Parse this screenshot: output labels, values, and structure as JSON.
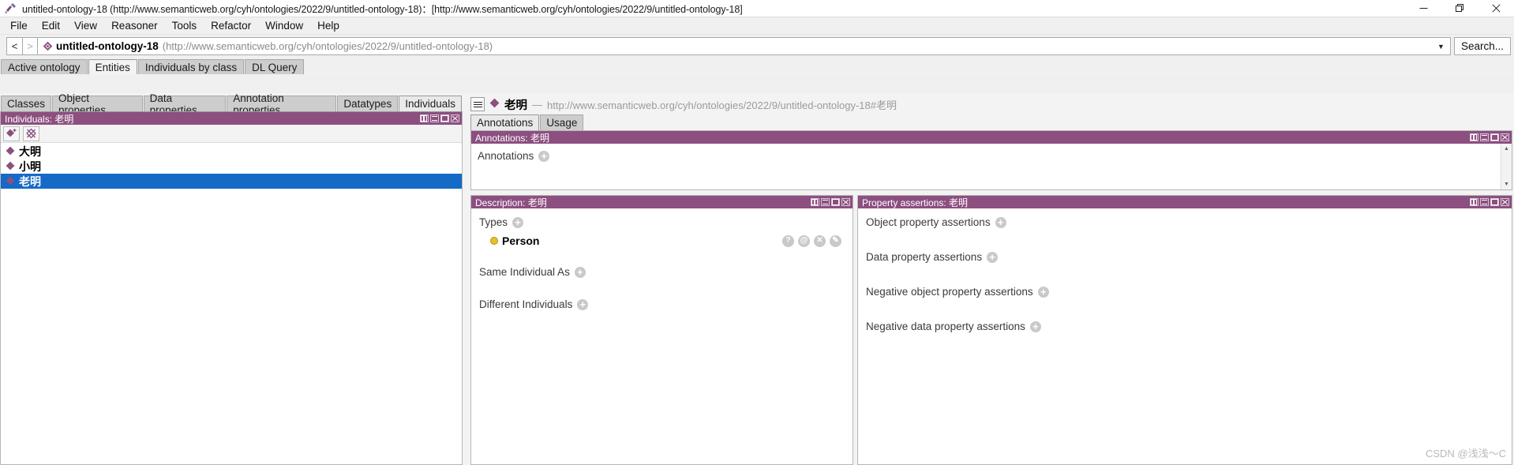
{
  "window": {
    "title": "untitled-ontology-18 (http://www.semanticweb.org/cyh/ontologies/2022/9/untitled-ontology-18)：[http://www.semanticweb.org/cyh/ontologies/2022/9/untitled-ontology-18]",
    "app_icon": "protege-icon",
    "controls": {
      "minimize": "minimize-icon",
      "restore": "restore-icon",
      "close": "close-icon"
    }
  },
  "menubar": {
    "items": [
      {
        "label": "File"
      },
      {
        "label": "Edit"
      },
      {
        "label": "View"
      },
      {
        "label": "Reasoner"
      },
      {
        "label": "Tools"
      },
      {
        "label": "Refactor"
      },
      {
        "label": "Window"
      },
      {
        "label": "Help"
      }
    ]
  },
  "navbar": {
    "back_label": "<",
    "forward_label": ">",
    "entity_name": "untitled-ontology-18",
    "entity_iri": "(http://www.semanticweb.org/cyh/ontologies/2022/9/untitled-ontology-18)",
    "dropdown_icon": "chevron-down-icon",
    "search_label": "Search..."
  },
  "top_tabs": [
    {
      "label": "Active ontology",
      "selected": false
    },
    {
      "label": "Entities",
      "selected": true
    },
    {
      "label": "Individuals by class",
      "selected": false
    },
    {
      "label": "DL Query",
      "selected": false
    }
  ],
  "sub_tabs": [
    {
      "label": "Classes",
      "selected": false
    },
    {
      "label": "Object properties",
      "selected": false
    },
    {
      "label": "Data properties",
      "selected": false
    },
    {
      "label": "Annotation properties",
      "selected": false
    },
    {
      "label": "Datatypes",
      "selected": false
    },
    {
      "label": "Individuals",
      "selected": true
    }
  ],
  "individuals_panel": {
    "header": "Individuals: 老明",
    "toolbar": [
      {
        "name": "add-individual-button",
        "icon": "diamond-plus-icon"
      },
      {
        "name": "delete-individual-button",
        "icon": "diamond-cross-icon"
      }
    ],
    "items": [
      {
        "label": "大明",
        "selected": false
      },
      {
        "label": "小明",
        "selected": false
      },
      {
        "label": "老明",
        "selected": true
      }
    ]
  },
  "entity_header": {
    "menu_icon": "hamburger-icon",
    "entity_icon": "individual-diamond-icon",
    "name": "老明",
    "dash": "—",
    "iri": "http://www.semanticweb.org/cyh/ontologies/2022/9/untitled-ontology-18#老明"
  },
  "entity_tabs": [
    {
      "label": "Annotations",
      "selected": true
    },
    {
      "label": "Usage",
      "selected": false
    }
  ],
  "annotations_panel": {
    "header": "Annotations: 老明",
    "row_label": "Annotations",
    "add_icon": "plus-circle-icon"
  },
  "description_panel": {
    "header": "Description: 老明",
    "sections": [
      {
        "label": "Types",
        "add_icon": "plus-circle-icon",
        "values": [
          {
            "label": "Person",
            "icon": "class-circle-icon",
            "color": "#eabf26",
            "buttons": [
              {
                "name": "explain-button",
                "glyph": "?"
              },
              {
                "name": "annotate-button",
                "glyph": "@"
              },
              {
                "name": "remove-button",
                "glyph": "✕"
              },
              {
                "name": "edit-button",
                "glyph": "✎"
              }
            ]
          }
        ]
      },
      {
        "label": "Same Individual As",
        "add_icon": "plus-circle-icon",
        "values": []
      },
      {
        "label": "Different Individuals",
        "add_icon": "plus-circle-icon",
        "values": []
      }
    ]
  },
  "property_assertions_panel": {
    "header": "Property assertions: 老明",
    "rows": [
      {
        "label": "Object property assertions",
        "add_icon": "plus-circle-icon"
      },
      {
        "label": "Data property assertions",
        "add_icon": "plus-circle-icon"
      },
      {
        "label": "Negative object property assertions",
        "add_icon": "plus-circle-icon"
      },
      {
        "label": "Negative data property assertions",
        "add_icon": "plus-circle-icon"
      }
    ]
  },
  "panel_buttons": {
    "restore": "panel-restore-icon",
    "minimize": "panel-minimize-icon",
    "maximize": "panel-maximize-icon",
    "close": "panel-close-icon"
  },
  "watermark": {
    "text": "CSDN @浅浅～C"
  },
  "colors": {
    "panel_header": "#8c4f80",
    "selection": "#1569c7",
    "individual": "#8c4f80",
    "class": "#eabf26"
  }
}
